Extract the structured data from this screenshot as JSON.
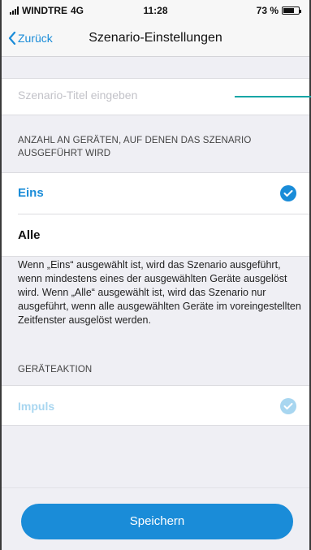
{
  "status_bar": {
    "carrier": "WINDTRE",
    "network": "4G",
    "time": "11:28",
    "battery": "73 %",
    "battery_level": 0.73
  },
  "nav": {
    "back_label": "Zurück",
    "title": "Szenario-Einstellungen"
  },
  "title_input": {
    "placeholder": "Szenario-Titel eingeben",
    "value": ""
  },
  "device_count": {
    "header": "ANZAHL AN GERÄTEN, AUF DENEN DAS SZENARIO AUSGEFÜHRT WIRD",
    "options": [
      {
        "label": "Eins",
        "selected": true
      },
      {
        "label": "Alle",
        "selected": false
      }
    ],
    "description": "Wenn „Eins“ ausgewählt ist, wird das Szenario ausgeführt, wenn mindestens eines der ausgewählten Geräte ausgelöst wird. Wenn „Alle“ ausgewählt ist, wird das Szenario nur ausgeführt, wenn alle ausgewählten Geräte im voreingestellten Zeitfenster ausgelöst werden."
  },
  "device_action": {
    "header": "GERÄTEAKTION",
    "option_label": "Impuls",
    "selected": true
  },
  "save_label": "Speichern",
  "colors": {
    "accent": "#1a8cd8",
    "accent_disabled": "#a8d6f0",
    "input_underline": "#17a6a6",
    "background": "#efeff4"
  }
}
